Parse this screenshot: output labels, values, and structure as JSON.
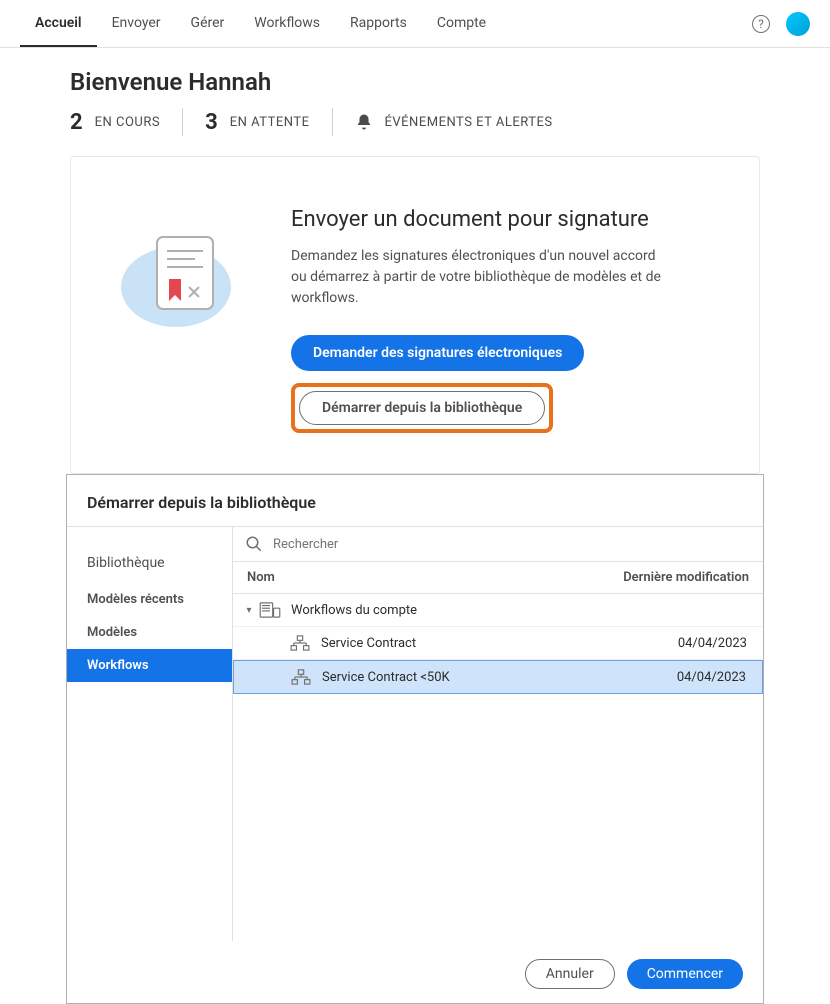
{
  "nav": {
    "tabs": [
      {
        "label": "Accueil",
        "active": true
      },
      {
        "label": "Envoyer",
        "active": false
      },
      {
        "label": "Gérer",
        "active": false
      },
      {
        "label": "Workflows",
        "active": false
      },
      {
        "label": "Rapports",
        "active": false
      },
      {
        "label": "Compte",
        "active": false
      }
    ],
    "help_glyph": "?"
  },
  "welcome": "Bienvenue Hannah",
  "stats": {
    "in_progress": {
      "num": "2",
      "label": "EN COURS"
    },
    "pending": {
      "num": "3",
      "label": "EN ATTENTE"
    },
    "events": {
      "label": "ÉVÉNEMENTS ET ALERTES"
    }
  },
  "hero": {
    "title": "Envoyer un document pour signature",
    "desc": "Demandez les signatures électroniques d'un nouvel accord ou démarrez à partir de votre bibliothèque de modèles et de workflows.",
    "primary_btn": "Demander des signatures électroniques",
    "secondary_btn": "Démarrer depuis la bibliothèque"
  },
  "dialog": {
    "title": "Démarrer depuis la bibliothèque",
    "search_placeholder": "Rechercher",
    "sidebar": {
      "title": "Bibliothèque",
      "items": [
        "Modèles récents",
        "Modèles",
        "Workflows"
      ]
    },
    "columns": {
      "name": "Nom",
      "modified": "Dernière modification"
    },
    "tree": {
      "group": "Workflows du compte",
      "rows": [
        {
          "name": "Service Contract",
          "date": "04/04/2023",
          "selected": false
        },
        {
          "name": "Service Contract <50K",
          "date": "04/04/2023",
          "selected": true
        }
      ]
    },
    "footer": {
      "cancel": "Annuler",
      "start": "Commencer"
    }
  }
}
